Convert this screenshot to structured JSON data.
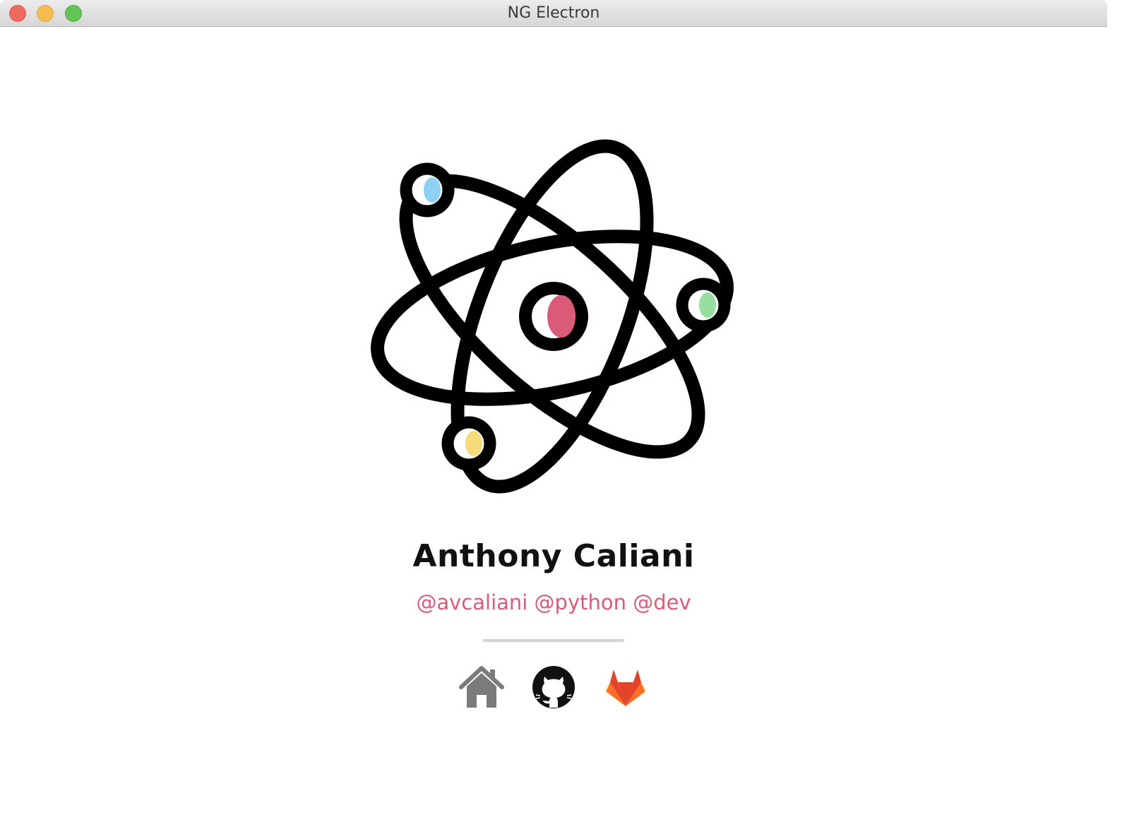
{
  "window": {
    "title": "NG Electron",
    "traffic_lights": [
      "close-icon",
      "minimize-icon",
      "zoom-icon"
    ]
  },
  "profile": {
    "name": "Anthony Caliani",
    "handles": "@avcaliani @python @dev"
  },
  "links": [
    {
      "icon": "home-icon"
    },
    {
      "icon": "github-icon"
    },
    {
      "icon": "gitlab-icon"
    }
  ],
  "colors": {
    "handles": "#d95b78",
    "nucleus": "#d95b78",
    "electron_blue": "#8fd1f5",
    "electron_green": "#96df9f",
    "electron_yellow": "#f7db7a",
    "home_icon": "#7b7b7b"
  }
}
